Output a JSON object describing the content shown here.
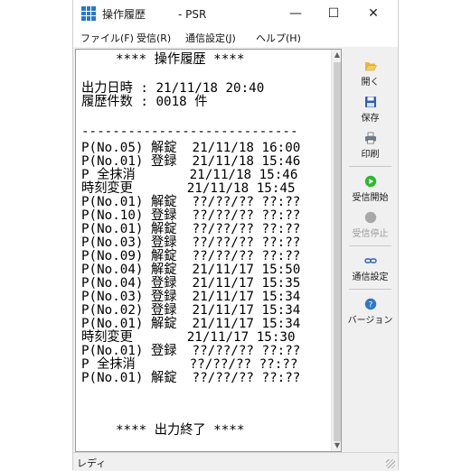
{
  "window": {
    "title": "操作履歴　　　- PSR",
    "minimize": "—",
    "maximize": "☐",
    "close": "✕"
  },
  "menu": [
    "ファイル(F)",
    "受信(R)",
    "通信設定(J)",
    "ヘルプ(H)"
  ],
  "log": {
    "header": "**** 操作履歴 ****",
    "date_line": "出力日時 : 21/11/18 20:40",
    "count_line": "履歴件数 : 0018 件",
    "separator": "----------------------------",
    "entries": [
      "P(No.05) 解錠  21/11/18 16:00",
      "P(No.01) 登録  21/11/18 15:46",
      "P 全抹消       21/11/18 15:46",
      "時刻変更       21/11/18 15:45",
      "P(No.01) 解錠  ??/??/?? ??:??",
      "P(No.10) 登録  ??/??/?? ??:??",
      "P(No.01) 解錠  ??/??/?? ??:??",
      "P(No.03) 登録  ??/??/?? ??:??",
      "P(No.09) 解錠  ??/??/?? ??:??",
      "P(No.04) 解錠  21/11/17 15:50",
      "P(No.04) 登録  21/11/17 15:35",
      "P(No.03) 登録  21/11/17 15:34",
      "P(No.02) 登録  21/11/17 15:34",
      "P(No.01) 解錠  21/11/17 15:34",
      "時刻変更       21/11/17 15:30",
      "P(No.01) 登録  ??/??/?? ??:??",
      "P 全抹消       ??/??/?? ??:??",
      "P(No.01) 解錠  ??/??/?? ??:??"
    ],
    "footer": "**** 出力終了 ****"
  },
  "toolbar": {
    "open": "開く",
    "save": "保存",
    "print": "印刷",
    "start_receive": "受信開始",
    "stop_receive": "受信停止",
    "comm_settings": "通信設定",
    "version": "バージョン"
  },
  "status": {
    "text": "レディ"
  },
  "colors": {
    "receive_start": "#2db82d",
    "receive_stop_disabled": "#a8a8a8",
    "accent": "#2b78c5"
  }
}
